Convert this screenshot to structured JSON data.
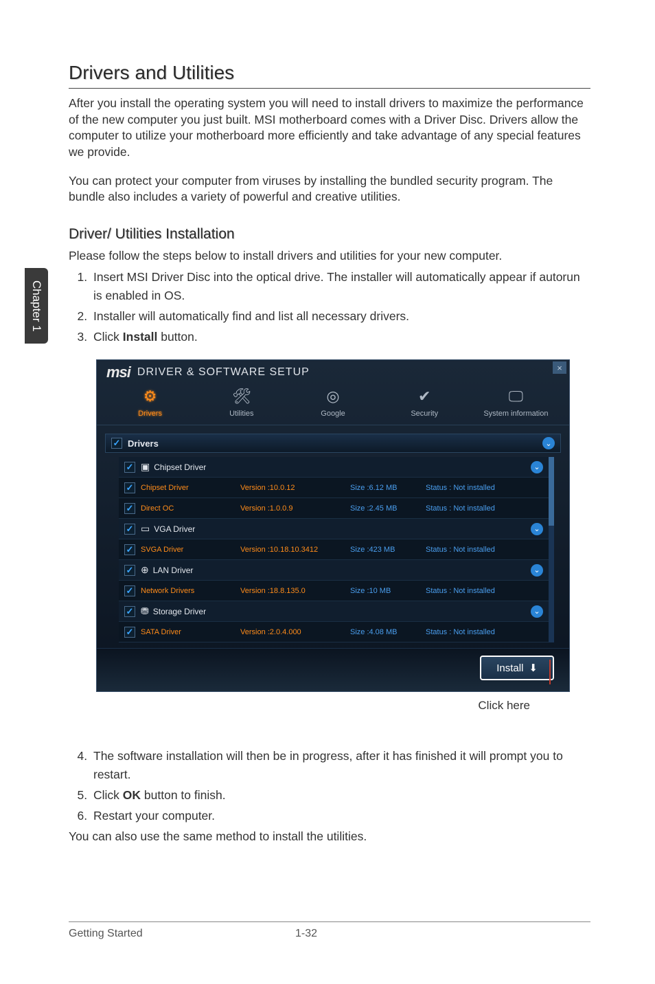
{
  "sideTab": "Chapter 1",
  "heading": "Drivers and Utilities",
  "para1": "After you install the operating system you will need to install drivers to maximize the performance of the new computer you just built. MSI motherboard comes with a Driver Disc. Drivers allow the computer to utilize your motherboard more efficiently and take advantage of any special features we provide.",
  "para2": "You can protect your computer from viruses by installing the bundled security program. The bundle also includes a variety of powerful and creative utilities.",
  "subheading": "Driver/ Utilities Installation",
  "para3": "Please follow the steps below to install drivers and utilities for your new computer.",
  "step1": "Insert MSI Driver Disc into the optical drive. The installer will automatically appear if autorun is enabled in OS.",
  "step2": "Installer will automatically find and list all necessary drivers.",
  "step3_a": "Click ",
  "step3_b": "Install",
  "step3_c": " button.",
  "installer": {
    "brand": "msi",
    "title": "DRIVER & SOFTWARE SETUP",
    "tabs": {
      "drivers": "Drivers",
      "utilities": "Utilities",
      "google": "Google",
      "security": "Security",
      "sysinfo": "System information"
    },
    "sectionTitle": "Drivers",
    "groups": [
      {
        "title": "Chipset Driver",
        "items": [
          {
            "name": "Chipset Driver",
            "version": "Version :10.0.12",
            "size": "Size :6.12 MB",
            "status": "Status : Not installed"
          },
          {
            "name": "Direct OC",
            "version": "Version :1.0.0.9",
            "size": "Size :2.45 MB",
            "status": "Status : Not installed"
          }
        ]
      },
      {
        "title": "VGA Driver",
        "items": [
          {
            "name": "SVGA Driver",
            "version": "Version :10.18.10.3412",
            "size": "Size :423 MB",
            "status": "Status : Not installed"
          }
        ]
      },
      {
        "title": "LAN Driver",
        "items": [
          {
            "name": "Network Drivers",
            "version": "Version :18.8.135.0",
            "size": "Size :10 MB",
            "status": "Status : Not installed"
          }
        ]
      },
      {
        "title": "Storage Driver",
        "items": [
          {
            "name": "SATA Driver",
            "version": "Version :2.0.4.000",
            "size": "Size :4.08 MB",
            "status": "Status : Not installed"
          }
        ]
      }
    ],
    "installBtn": "Install"
  },
  "callout": "Click here",
  "step4": "The software installation will then be in progress, after it has finished it will prompt you to restart.",
  "step5_a": "Click ",
  "step5_b": "OK",
  "step5_c": " button to finish.",
  "step6": "Restart your computer.",
  "para4": "You can also use the same method to install the utilities.",
  "footer": {
    "left": "Getting Started",
    "page": "1-32"
  }
}
